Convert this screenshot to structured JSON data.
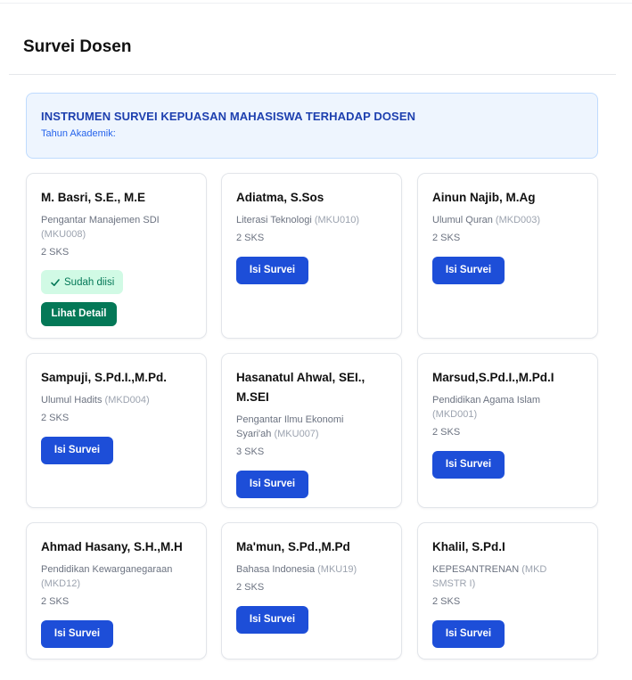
{
  "page": {
    "title": "Survei Dosen"
  },
  "banner": {
    "title": "INSTRUMEN SURVEI KEPUASAN MAHASISWA TERHADAP DOSEN",
    "subtitle": "Tahun Akademik:"
  },
  "colors": {
    "primary_button": "#1d4ed8",
    "detail_button": "#047857",
    "done_badge_bg": "#d1fae5",
    "banner_bg": "#eef5fe"
  },
  "cards": [
    {
      "lecturer": "M. Basri, S.E., M.E",
      "course": "Pengantar Manajemen SDI",
      "code": "(MKU008)",
      "sks": "2 SKS",
      "status": "done",
      "badge_label": "Sudah diisi",
      "badge_icon": "check-icon",
      "action_label": "Lihat Detail"
    },
    {
      "lecturer": "Adiatma, S.Sos",
      "course": "Literasi Teknologi",
      "code": "(MKU010)",
      "sks": "2 SKS",
      "status": "pending",
      "action_label": "Isi Survei"
    },
    {
      "lecturer": "Ainun Najib, M.Ag",
      "course": "Ulumul Quran",
      "code": "(MKD003)",
      "sks": "2 SKS",
      "status": "pending",
      "action_label": "Isi Survei"
    },
    {
      "lecturer": "Sampuji, S.Pd.I.,M.Pd.",
      "course": "Ulumul Hadits",
      "code": "(MKD004)",
      "sks": "2 SKS",
      "status": "pending",
      "action_label": "Isi Survei"
    },
    {
      "lecturer": "Hasanatul Ahwal, SEI., M.SEI",
      "course": "Pengantar Ilmu Ekonomi Syari'ah",
      "code": "(MKU007)",
      "sks": "3 SKS",
      "status": "pending",
      "action_label": "Isi Survei"
    },
    {
      "lecturer": "Marsud,S.Pd.I.,M.Pd.I",
      "course": "Pendidikan Agama Islam",
      "code": "(MKD001)",
      "sks": "2 SKS",
      "status": "pending",
      "action_label": "Isi Survei"
    },
    {
      "lecturer": "Ahmad Hasany, S.H.,M.H",
      "course": "Pendidikan Kewarganegaraan",
      "code": "(MKD12)",
      "sks": "2 SKS",
      "status": "pending",
      "action_label": "Isi Survei"
    },
    {
      "lecturer": "Ma'mun, S.Pd.,M.Pd",
      "course": "Bahasa Indonesia",
      "code": "(MKU19)",
      "sks": "2 SKS",
      "status": "pending",
      "action_label": "Isi Survei"
    },
    {
      "lecturer": "Khalil, S.Pd.I",
      "course": "KEPESANTRENAN",
      "code": "(MKD SMSTR I)",
      "sks": "2 SKS",
      "status": "pending",
      "action_label": "Isi Survei"
    }
  ]
}
